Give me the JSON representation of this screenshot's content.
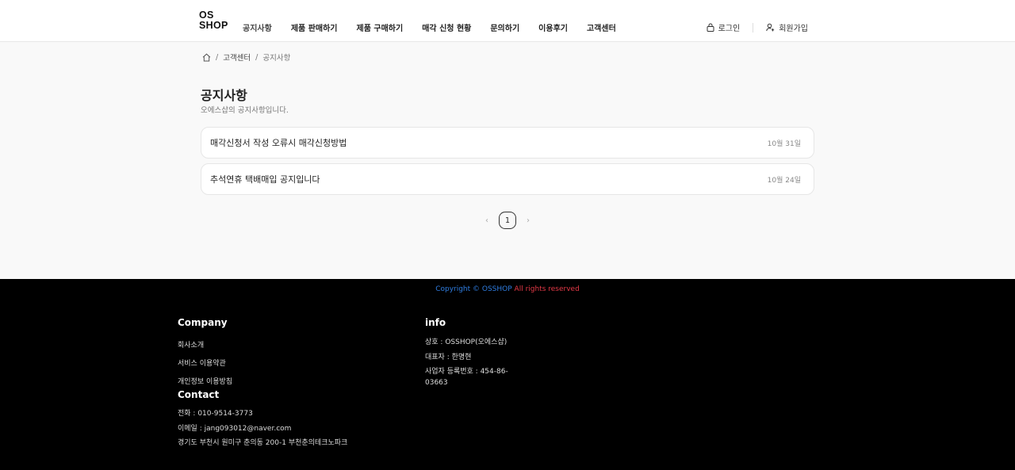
{
  "header": {
    "logo_line1": "OS",
    "logo_line2": "SHOP",
    "nav": [
      "공지사항",
      "제품 판매하기",
      "제품 구매하기",
      "매각 신청 현황",
      "문의하기",
      "이용후기",
      "고객센터"
    ],
    "login_label": "로그인",
    "signup_label": "회원가입"
  },
  "breadcrumb": {
    "home_icon": "home-icon",
    "parent": "고객센터",
    "current": "공지사항"
  },
  "page": {
    "title": "공지사항",
    "subtitle": "오에스샵의 공지사항입니다."
  },
  "notices": [
    {
      "title": "매각신청서 작성 오류시 매각신청방법",
      "date": "10월 31일"
    },
    {
      "title": "추석연휴 택배매입 공지입니다",
      "date": "10월 24일"
    }
  ],
  "pagination": {
    "prev": "‹",
    "current": "1",
    "next": "›"
  },
  "footer": {
    "copyright_main": "Copyright © OSSHOP ",
    "copyright_tail": "All rights reserved",
    "company_heading": "Company",
    "company_links": [
      "회사소개",
      "서비스 이용약관",
      "개인정보 이용방침"
    ],
    "contact_heading": "Contact",
    "contact_phone": "전화 : 010-9514-3773",
    "contact_email": "이메일 : jang093012@naver.com",
    "contact_address": "경기도 부천시 원미구 춘의동 200-1 부천춘의테크노파크",
    "info_heading": "info",
    "info_name": "상호 : OSSHOP(오에스샵)",
    "info_ceo": "대표자 : 한명현",
    "info_bizno": "사업자 등록번호 : 454-86-03663"
  },
  "colors": {
    "copyright_blue": "#2f7de1",
    "copyright_red": "#e53947",
    "footer_bg": "#000000",
    "page_bg": "#f9f9f9"
  }
}
